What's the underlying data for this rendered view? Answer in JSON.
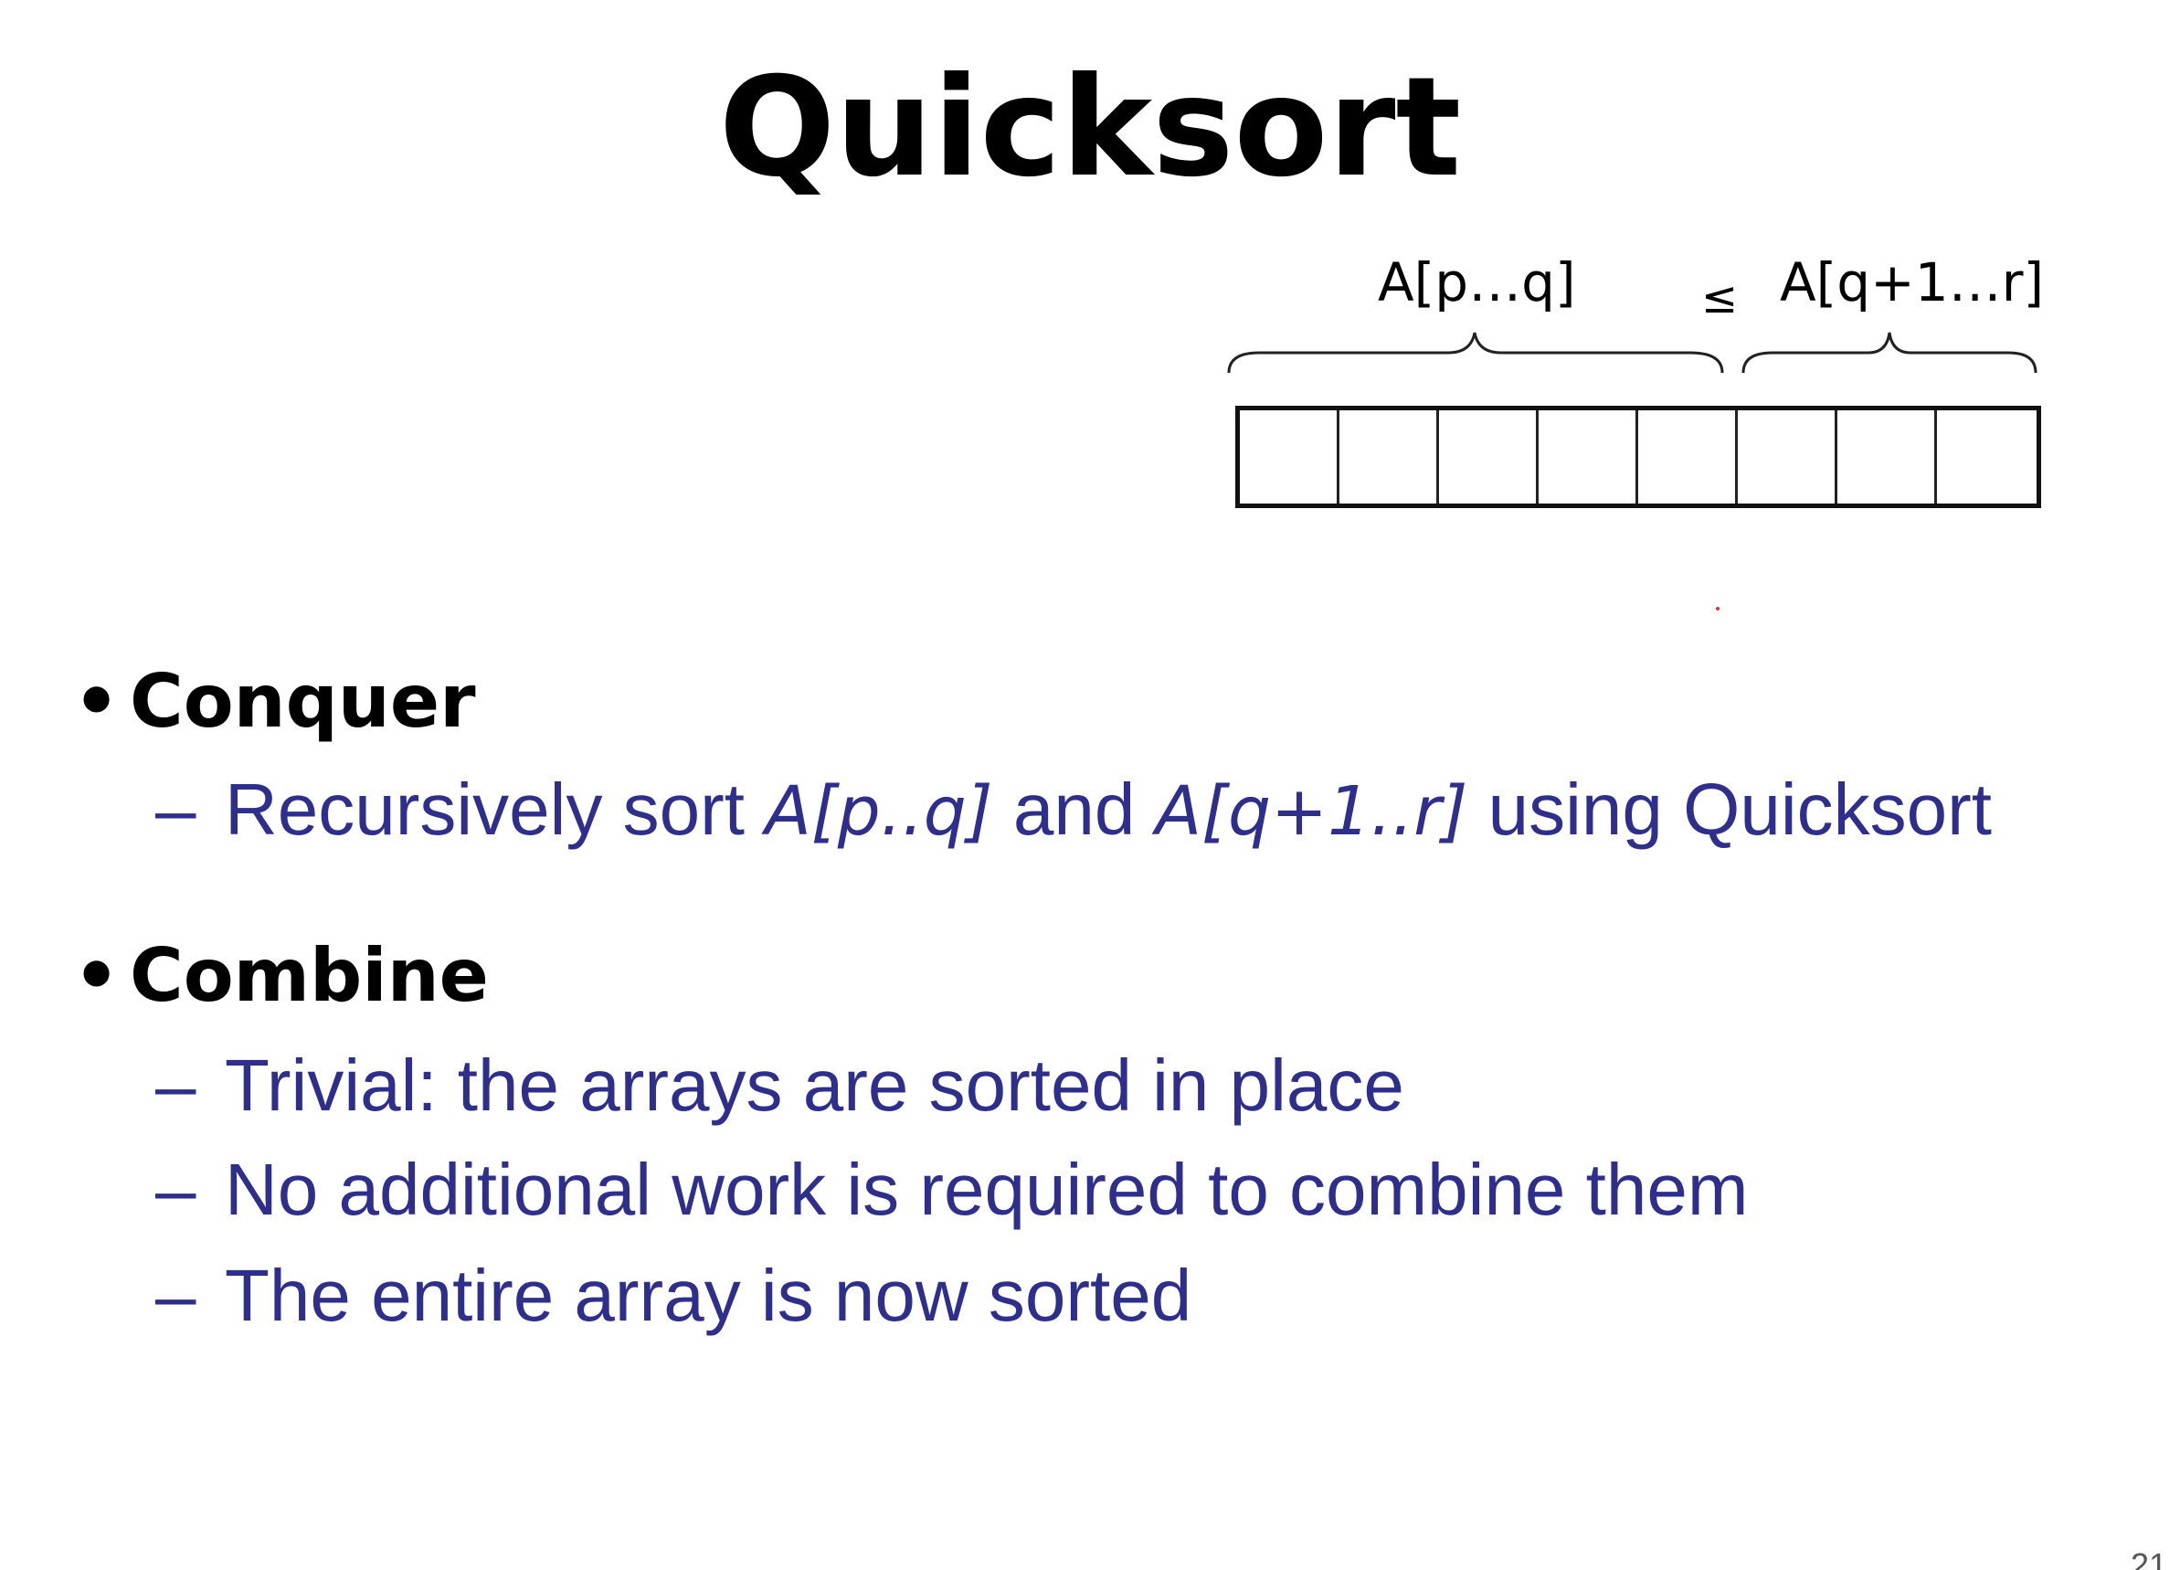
{
  "slide": {
    "title": "Quicksort",
    "diagram": {
      "left_label": "A[p…q]",
      "relation": "≤",
      "right_label": "A[q+1…r]",
      "cell_count": 8
    },
    "sections": [
      {
        "bullet": "•",
        "heading": "Conquer",
        "items": [
          {
            "dash": "–",
            "parts": [
              "Recursively sort ",
              "A[p..q]",
              " and ",
              "A[q+1..r]",
              " using Quicksort"
            ]
          }
        ]
      },
      {
        "bullet": "•",
        "heading": "Combine",
        "items": [
          {
            "dash": "–",
            "text": "Trivial: the arrays are sorted in place"
          },
          {
            "dash": "–",
            "text": "No additional work is required to combine them"
          },
          {
            "dash": "–",
            "text": "The entire array is now sorted"
          }
        ]
      }
    ],
    "page_number": "21"
  }
}
